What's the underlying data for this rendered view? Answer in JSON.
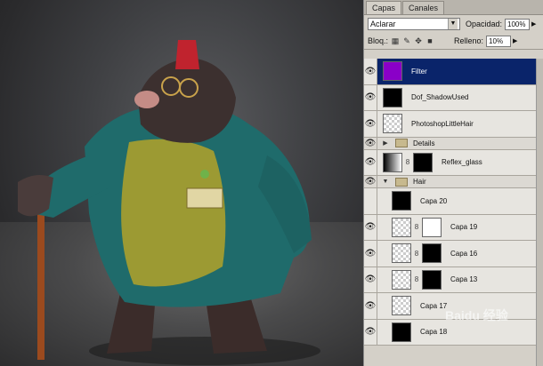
{
  "tabs": [
    "Capas",
    "Canales"
  ],
  "blend_mode": "Aclarar",
  "opacity_label": "Opacidad:",
  "opacity_value": "100%",
  "lock_label": "Bloq.:",
  "fill_label": "Relleno:",
  "fill_value": "10%",
  "layers": [
    {
      "name": "Filter",
      "selected": true,
      "thumb": "purple"
    },
    {
      "name": "Dof_ShadowUsed",
      "selected": false,
      "thumb": "black"
    },
    {
      "name": "PhotoshopLittleHair",
      "selected": false,
      "thumb": "checker"
    },
    {
      "name": "Details",
      "group": true,
      "collapsed": true
    },
    {
      "name": "Reflex_glass",
      "selected": false,
      "thumb": "gradient",
      "mask": "black"
    },
    {
      "name": "Hair",
      "group": true,
      "collapsed": false
    },
    {
      "name": "Capa 20",
      "selected": false,
      "thumb": "black-top"
    },
    {
      "name": "Capa 19",
      "selected": false,
      "thumb": "checker",
      "mask": "white"
    },
    {
      "name": "Capa 16",
      "selected": false,
      "thumb": "checker",
      "mask": "black"
    },
    {
      "name": "Capa 13",
      "selected": false,
      "thumb": "checker",
      "mask": "black"
    },
    {
      "name": "Capa 17",
      "selected": false,
      "thumb": "checker"
    },
    {
      "name": "Capa 18",
      "selected": false,
      "thumb": "black"
    }
  ],
  "watermark": "Baidu 经验"
}
